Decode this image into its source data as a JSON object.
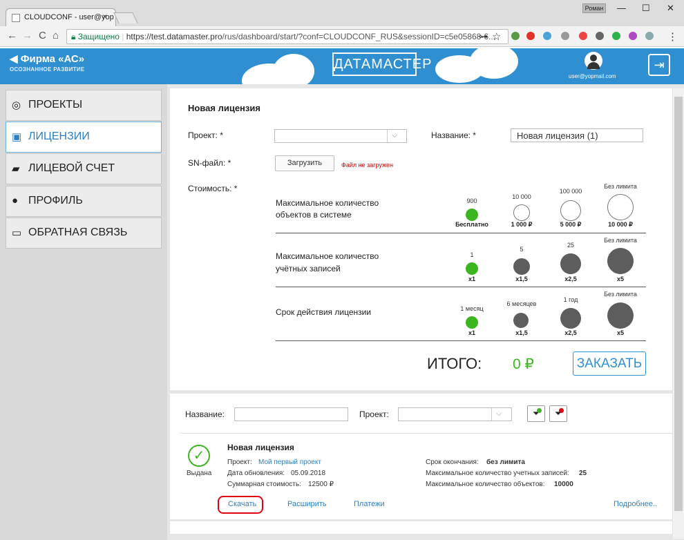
{
  "browser": {
    "tab_title": "CLOUDCONF - user@yop",
    "tab_close": "×",
    "profile_label": "Роман",
    "win_min": "—",
    "win_max": "☐",
    "win_close": "✕",
    "back": "←",
    "forward": "→",
    "reload": "C",
    "home": "⌂",
    "secure_label": "Защищено",
    "url_host": "https://test.datamaster.pro",
    "url_path": "/rus/dashboard/start/?conf=CLOUDCONF_RUS&sessionID=c5e05868-6...",
    "key_icon": "⊶",
    "star_icon": "☆",
    "menu_icon": "⋮"
  },
  "header": {
    "logo": "Фирма «АС»",
    "logo_sub": "ОСОЗНАННОЕ РАЗВИТИЕ",
    "brand": "ДАТАМАСТЕР",
    "user_email": "user@yopmail.com",
    "exit_icon": "⇥"
  },
  "sidebar": {
    "items": [
      {
        "label": "ПРОЕКТЫ",
        "icon": "◎"
      },
      {
        "label": "ЛИЦЕНЗИИ",
        "icon": "▣"
      },
      {
        "label": "ЛИЦЕВОЙ СЧЕТ",
        "icon": "▰"
      },
      {
        "label": "ПРОФИЛЬ",
        "icon": "●"
      },
      {
        "label": "ОБРАТНАЯ СВЯЗЬ",
        "icon": "▭"
      }
    ]
  },
  "form": {
    "title": "Новая лицензия",
    "project_label": "Проект: *",
    "name_label": "Название: *",
    "name_value": "Новая лицензия (1)",
    "sn_label": "SN-файл: *",
    "upload_button": "Загрузить",
    "file_status": "Файл не загружен",
    "cost_label": "Стоимость: *",
    "rows": [
      {
        "label1": "Максимальное количество",
        "label2": "объектов в системе",
        "options": [
          {
            "top": "900",
            "bottom": "Бесплатно"
          },
          {
            "top": "10 000",
            "bottom": "1 000 ₽"
          },
          {
            "top": "100 000",
            "bottom": "5 000 ₽"
          },
          {
            "top": "Без лимита",
            "bottom": "10 000 ₽"
          }
        ]
      },
      {
        "label1": "Максимальное количество",
        "label2": "учётных записей",
        "options": [
          {
            "top": "1",
            "bottom": "x1"
          },
          {
            "top": "5",
            "bottom": "x1,5"
          },
          {
            "top": "25",
            "bottom": "x2,5"
          },
          {
            "top": "Без лимита",
            "bottom": "x5"
          }
        ]
      },
      {
        "label1": "Срок действия лицензии",
        "label2": "",
        "options": [
          {
            "top": "1 месяц",
            "bottom": "x1"
          },
          {
            "top": "6 месяцев",
            "bottom": "x1,5"
          },
          {
            "top": "1 год",
            "bottom": "x2,5"
          },
          {
            "top": "Без лимита",
            "bottom": "x5"
          }
        ]
      }
    ],
    "total_label": "ИТОГО:",
    "total_value": "0 ₽",
    "order_button": "ЗАКАЗАТЬ"
  },
  "filter": {
    "name_label": "Название:",
    "project_label": "Проект:"
  },
  "license": {
    "status": "Выдана",
    "title": "Новая лицензия",
    "project_label": "Проект:",
    "project_value": "Мой первый проект",
    "updated_label": "Дата обновления:",
    "updated_value": "05.09.2018",
    "cost_label": "Суммарная стоимость:",
    "cost_value": "12500 ₽",
    "expiry_label": "Срок окончания:",
    "expiry_value": "без лимита",
    "accounts_label": "Максимальное количество учетных записей:",
    "accounts_value": "25",
    "objects_label": "Максимальное количество объектов:",
    "objects_value": "10000",
    "download": "Скачать",
    "extend": "Расширить",
    "payments": "Платежи",
    "more": "Подробнее.."
  },
  "colors": {
    "accent": "#2f8fd0",
    "green": "#3cb521",
    "highlight": "#e0000f"
  }
}
